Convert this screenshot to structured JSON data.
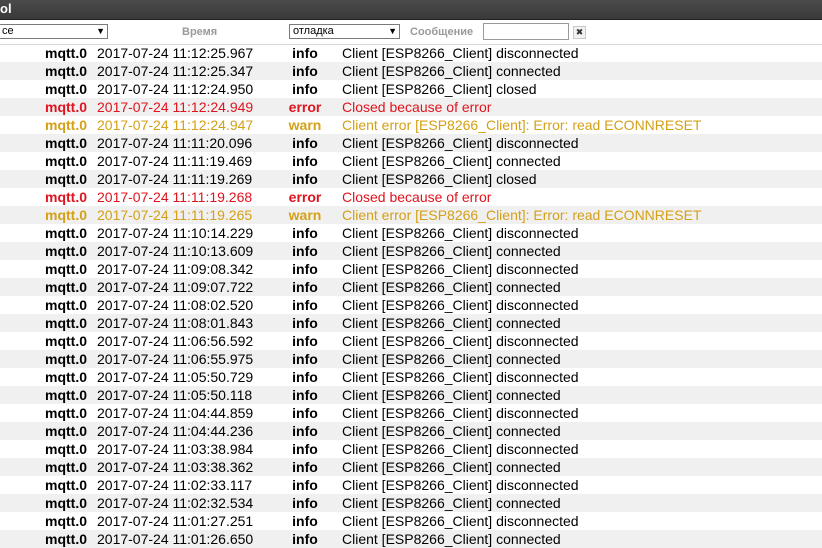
{
  "window": {
    "title_fragment": "ol"
  },
  "filters": {
    "source_select": {
      "value": "ce"
    },
    "time_header": "Время",
    "level_select": {
      "value": "отладка"
    },
    "message_header": "Сообщение",
    "message_input": {
      "value": ""
    },
    "clear_label": "✖"
  },
  "colors": {
    "info": "#000000",
    "error": "#e0141e",
    "warn": "#d4a017",
    "stripe": "#f0f0f0"
  },
  "log": [
    {
      "source": "mqtt.0",
      "time": "2017-07-24 11:12:25.967",
      "level": "info",
      "message": "Client [ESP8266_Client] disconnected"
    },
    {
      "source": "mqtt.0",
      "time": "2017-07-24 11:12:25.347",
      "level": "info",
      "message": "Client [ESP8266_Client] connected"
    },
    {
      "source": "mqtt.0",
      "time": "2017-07-24 11:12:24.950",
      "level": "info",
      "message": "Client [ESP8266_Client] closed"
    },
    {
      "source": "mqtt.0",
      "time": "2017-07-24 11:12:24.949",
      "level": "error",
      "message": "Closed because of error"
    },
    {
      "source": "mqtt.0",
      "time": "2017-07-24 11:12:24.947",
      "level": "warn",
      "message": "Client error [ESP8266_Client]: Error: read ECONNRESET"
    },
    {
      "source": "mqtt.0",
      "time": "2017-07-24 11:11:20.096",
      "level": "info",
      "message": "Client [ESP8266_Client] disconnected"
    },
    {
      "source": "mqtt.0",
      "time": "2017-07-24 11:11:19.469",
      "level": "info",
      "message": "Client [ESP8266_Client] connected"
    },
    {
      "source": "mqtt.0",
      "time": "2017-07-24 11:11:19.269",
      "level": "info",
      "message": "Client [ESP8266_Client] closed"
    },
    {
      "source": "mqtt.0",
      "time": "2017-07-24 11:11:19.268",
      "level": "error",
      "message": "Closed because of error"
    },
    {
      "source": "mqtt.0",
      "time": "2017-07-24 11:11:19.265",
      "level": "warn",
      "message": "Client error [ESP8266_Client]: Error: read ECONNRESET"
    },
    {
      "source": "mqtt.0",
      "time": "2017-07-24 11:10:14.229",
      "level": "info",
      "message": "Client [ESP8266_Client] disconnected"
    },
    {
      "source": "mqtt.0",
      "time": "2017-07-24 11:10:13.609",
      "level": "info",
      "message": "Client [ESP8266_Client] connected"
    },
    {
      "source": "mqtt.0",
      "time": "2017-07-24 11:09:08.342",
      "level": "info",
      "message": "Client [ESP8266_Client] disconnected"
    },
    {
      "source": "mqtt.0",
      "time": "2017-07-24 11:09:07.722",
      "level": "info",
      "message": "Client [ESP8266_Client] connected"
    },
    {
      "source": "mqtt.0",
      "time": "2017-07-24 11:08:02.520",
      "level": "info",
      "message": "Client [ESP8266_Client] disconnected"
    },
    {
      "source": "mqtt.0",
      "time": "2017-07-24 11:08:01.843",
      "level": "info",
      "message": "Client [ESP8266_Client] connected"
    },
    {
      "source": "mqtt.0",
      "time": "2017-07-24 11:06:56.592",
      "level": "info",
      "message": "Client [ESP8266_Client] disconnected"
    },
    {
      "source": "mqtt.0",
      "time": "2017-07-24 11:06:55.975",
      "level": "info",
      "message": "Client [ESP8266_Client] connected"
    },
    {
      "source": "mqtt.0",
      "time": "2017-07-24 11:05:50.729",
      "level": "info",
      "message": "Client [ESP8266_Client] disconnected"
    },
    {
      "source": "mqtt.0",
      "time": "2017-07-24 11:05:50.118",
      "level": "info",
      "message": "Client [ESP8266_Client] connected"
    },
    {
      "source": "mqtt.0",
      "time": "2017-07-24 11:04:44.859",
      "level": "info",
      "message": "Client [ESP8266_Client] disconnected"
    },
    {
      "source": "mqtt.0",
      "time": "2017-07-24 11:04:44.236",
      "level": "info",
      "message": "Client [ESP8266_Client] connected"
    },
    {
      "source": "mqtt.0",
      "time": "2017-07-24 11:03:38.984",
      "level": "info",
      "message": "Client [ESP8266_Client] disconnected"
    },
    {
      "source": "mqtt.0",
      "time": "2017-07-24 11:03:38.362",
      "level": "info",
      "message": "Client [ESP8266_Client] connected"
    },
    {
      "source": "mqtt.0",
      "time": "2017-07-24 11:02:33.117",
      "level": "info",
      "message": "Client [ESP8266_Client] disconnected"
    },
    {
      "source": "mqtt.0",
      "time": "2017-07-24 11:02:32.534",
      "level": "info",
      "message": "Client [ESP8266_Client] connected"
    },
    {
      "source": "mqtt.0",
      "time": "2017-07-24 11:01:27.251",
      "level": "info",
      "message": "Client [ESP8266_Client] disconnected"
    },
    {
      "source": "mqtt.0",
      "time": "2017-07-24 11:01:26.650",
      "level": "info",
      "message": "Client [ESP8266_Client] connected"
    }
  ]
}
